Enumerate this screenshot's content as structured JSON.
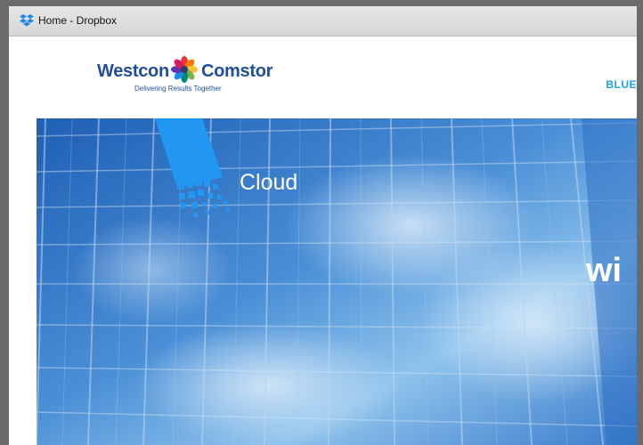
{
  "window": {
    "title": "Home - Dropbox",
    "favicon": "dropbox-icon"
  },
  "header": {
    "logo": {
      "word_left": "Westcon",
      "word_right": "Comstor",
      "tagline": "Delivering Results Together",
      "brand_color": "#1f4e9a"
    },
    "nav_link": "BLUE"
  },
  "hero": {
    "heading": "Cloud",
    "partial_text": "wi",
    "accent_color": "#1da1f2"
  }
}
